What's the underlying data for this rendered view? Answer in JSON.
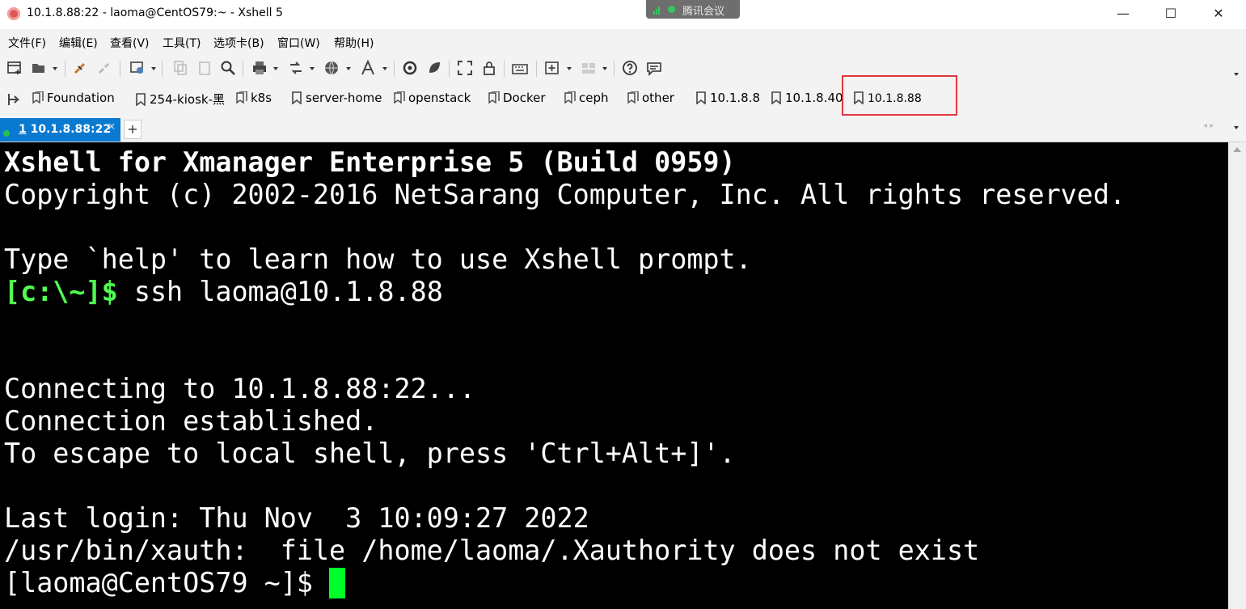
{
  "window": {
    "title": "10.1.8.88:22 - laoma@CentOS79:~ - Xshell 5",
    "minimize_glyph": "—",
    "maximize_glyph": "☐",
    "close_glyph": "✕"
  },
  "meeting_badge": {
    "label": "腾讯会议"
  },
  "menu": {
    "items": [
      "文件(F)",
      "编辑(E)",
      "查看(V)",
      "工具(T)",
      "选项卡(B)",
      "窗口(W)",
      "帮助(H)"
    ]
  },
  "toolbar": {
    "icons": [
      "new-session-icon",
      "open-icon",
      "connect-icon",
      "disconnect-icon",
      "properties-icon",
      "copy-icon",
      "paste-icon",
      "find-icon",
      "print-icon",
      "transfer-icon",
      "globe-icon",
      "font-icon",
      "xftp-icon",
      "xmanager-icon",
      "fullscreen-icon",
      "lock-icon",
      "keyboard-icon",
      "new-tab-icon",
      "layout-icon",
      "help-icon",
      "chat-icon"
    ]
  },
  "links": {
    "items": [
      {
        "label": "Foundation",
        "type": "folder"
      },
      {
        "label": "254-kiosk-黑",
        "type": "bookmark"
      },
      {
        "label": "k8s",
        "type": "folder"
      },
      {
        "label": "server-home",
        "type": "bookmark"
      },
      {
        "label": "openstack",
        "type": "folder"
      },
      {
        "label": "Docker",
        "type": "folder"
      },
      {
        "label": "ceph",
        "type": "folder"
      },
      {
        "label": "other",
        "type": "folder"
      },
      {
        "label": "10.1.8.8",
        "type": "bookmark"
      },
      {
        "label": "10.1.8.40",
        "type": "bookmark"
      },
      {
        "label": "10.1.8.88",
        "type": "bookmark"
      }
    ]
  },
  "tabs": {
    "active": {
      "number": "1",
      "label": "10.1.8.88:22",
      "close": "×"
    },
    "add": "+"
  },
  "terminal": {
    "lines": {
      "l1": "Xshell for Xmanager Enterprise 5 (Build 0959)",
      "l2": "Copyright (c) 2002-2016 NetSarang Computer, Inc. All rights reserved.",
      "l3": "Type `help' to learn how to use Xshell prompt.",
      "l4_prompt": "[c:\\~]$",
      "l4_cmd": " ssh laoma@10.1.8.88",
      "l5": "Connecting to 10.1.8.88:22...",
      "l6": "Connection established.",
      "l7": "To escape to local shell, press 'Ctrl+Alt+]'.",
      "l8": "Last login: Thu Nov  3 10:09:27 2022",
      "l9": "/usr/bin/xauth:  file /home/laoma/.Xauthority does not exist",
      "l10": "[laoma@CentOS79 ~]$ "
    }
  },
  "colors": {
    "terminal_bg": "#000000",
    "terminal_fg": "#ffffff",
    "prompt_green": "#4fff4f",
    "cursor": "#00ff2a",
    "tab_active": "#0a7ad1",
    "highlight": "#e0373f"
  }
}
